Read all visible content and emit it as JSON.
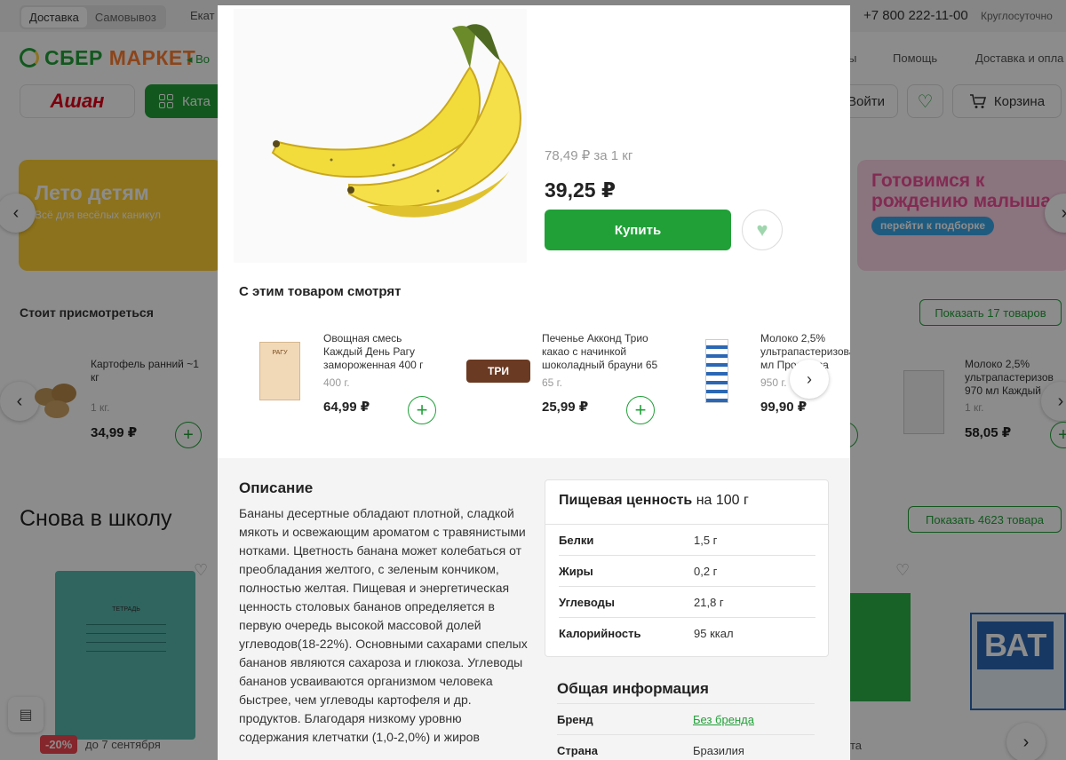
{
  "topbar": {
    "delivery_tab": "Доставка",
    "pickup_tab": "Самовывоз",
    "city": "Екат",
    "phone": "+7 800 222-11-00",
    "phone_note": "Круглосуточно"
  },
  "header": {
    "logo_sber": "СБЕР",
    "logo_market": "МАРКЕТ",
    "address_short": "Во",
    "nav": [
      "ы",
      "Помощь",
      "Доставка и опла"
    ],
    "store": "Ашан",
    "catalog_label": "Ката",
    "login_label": "Войти",
    "cart_label": "Корзина"
  },
  "banners": {
    "left_title": "Лето детям",
    "left_sub": "Всё для весёлых каникул",
    "right_title": "Готовимся к рождению малыша",
    "right_pill": "перейти к подборке"
  },
  "section1": {
    "title": "Стоит присмотреться",
    "show_more": "Показать 17 товаров",
    "card_left": {
      "name": "Картофель ранний ~1 кг",
      "weight": "1 кг.",
      "price": "34,99 ₽"
    },
    "card_right": {
      "name": "Молоко 2,5% ультрапастеризов 970 мл Каждый д",
      "weight": "1 кг.",
      "price": "58,05 ₽"
    }
  },
  "section2": {
    "title": "Снова в школу",
    "show_more": "Показать 4623 товара",
    "notebook_label": "ТЕТРАДЬ",
    "discount": "-20%",
    "discount_note": "до 7 сентября",
    "bath_text": "ВАТ",
    "partial_text": "та"
  },
  "modal": {
    "old_price": "78,49 ₽ за 1 кг",
    "price": "39,25 ₽",
    "buy_label": "Купить",
    "also_title": "С этим товаром смотрят",
    "also": [
      {
        "name": "Овощная смесь Каждый День Рагу замороженная 400 г",
        "weight": "400 г.",
        "price": "64,99 ₽",
        "thumb": "РАГУ"
      },
      {
        "name": "Печенье Акконд Трио какао с начинкой шоколадный брауни 65",
        "weight": "65 г.",
        "price": "25,99 ₽",
        "thumb": "ТРИ"
      },
      {
        "name": "Молоко 2,5% ультрапастеризова 950 мл Простоква",
        "weight": "950 г.",
        "price": "99,90 ₽",
        "thumb": ""
      }
    ],
    "description_title": "Описание",
    "description": "Бананы десертные обладают плотной, сладкой мякоть и освежающим ароматом с травянистыми нотками. Цветность банана может колебаться от преобладания желтого, с зеленым кончиком, полностью желтая. Пищевая и энергетическая ценность столовых бананов определяется в первую очередь высокой массовой долей углеводов(18-22%). Основными сахарами спелых бананов являются сахароза и глюкоза. Углеводы бананов усваиваются организмом человека быстрее, чем углеводы картофеля и др. продуктов. Благодаря низкому уровню содержания клетчатки (1,0-2,0%) и жиров",
    "nutrition_title": "Пищевая ценность",
    "nutrition_per": "на 100 г",
    "nutrition": [
      {
        "k": "Белки",
        "v": "1,5 г"
      },
      {
        "k": "Жиры",
        "v": "0,2 г"
      },
      {
        "k": "Углеводы",
        "v": "21,8 г"
      },
      {
        "k": "Калорийность",
        "v": "95 ккал"
      }
    ],
    "general_title": "Общая информация",
    "general": [
      {
        "k": "Бренд",
        "v": "Без бренда"
      },
      {
        "k": "Страна",
        "v": "Бразилия"
      }
    ]
  },
  "colors": {
    "accent": "#21a038",
    "brand_orange": "#ff7f32",
    "overlay": "rgba(0,0,0,0.45)"
  }
}
